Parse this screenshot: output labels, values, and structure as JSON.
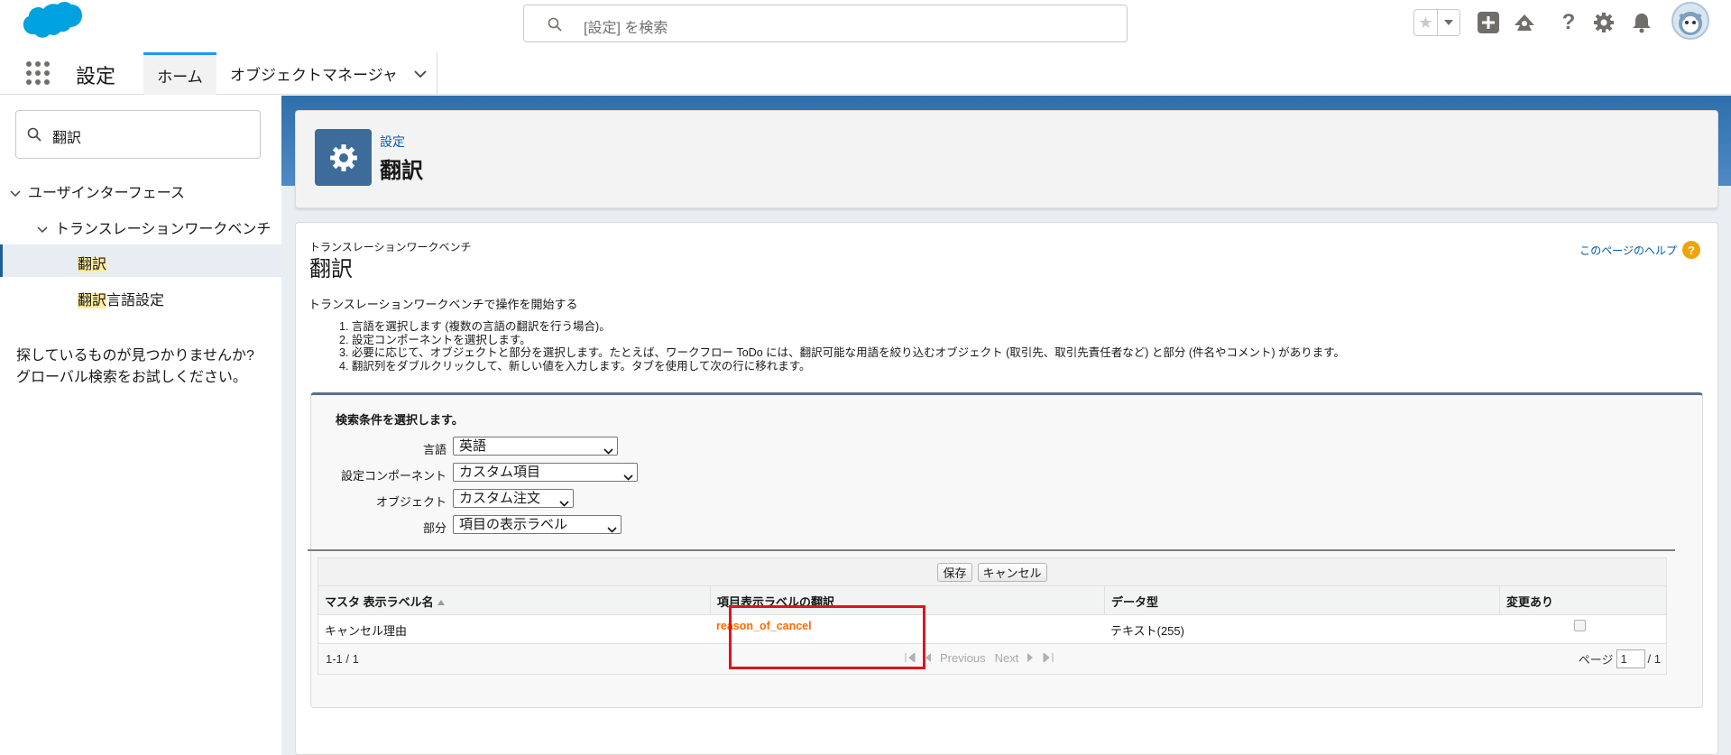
{
  "search": {
    "placeholder": "[設定] を検索"
  },
  "nav": {
    "app_name": "設定",
    "tab_home": "ホーム",
    "tab_object_manager": "オブジェクトマネージャ"
  },
  "sidebar": {
    "quick_find_value": "翻訳",
    "tree": [
      {
        "label": "ユーザインターフェース"
      },
      {
        "label": "トランスレーションワークベンチ"
      },
      {
        "highlight": "翻訳",
        "rest": ""
      },
      {
        "highlight": "翻訳",
        "rest": "言語設定"
      }
    ],
    "not_found_line1": "探しているものが見つかりませんか?",
    "not_found_line2": "グローバル検索をお試しください。"
  },
  "header": {
    "breadcrumb": "設定",
    "title": "翻訳"
  },
  "content": {
    "subtitle": "トランスレーションワークベンチ",
    "title": "翻訳",
    "help_link": "このページのヘルプ",
    "intro": "トランスレーションワークベンチで操作を開始する",
    "steps": [
      "1. 言語を選択します (複数の言語の翻訳を行う場合)。",
      "2. 設定コンポーネントを選択します。",
      "3. 必要に応じて、オブジェクトと部分を選択します。たとえば、ワークフロー ToDo には、翻訳可能な用語を絞り込むオブジェクト (取引先、取引先責任者など) と部分 (件名やコメント) があります。",
      "4. 翻訳列をダブルクリックして、新しい値を入力します。タブを使用して次の行に移れます。"
    ],
    "criteria_title": "検索条件を選択します。",
    "filters": {
      "language": {
        "label": "言語",
        "value": "英語"
      },
      "component": {
        "label": "設定コンポーネント",
        "value": "カスタム項目"
      },
      "object": {
        "label": "オブジェクト",
        "value": "カスタム注文"
      },
      "aspect": {
        "label": "部分",
        "value": "項目の表示ラベル"
      }
    },
    "save_button": "保存",
    "cancel_button": "キャンセル",
    "columns": {
      "master": "マスタ 表示ラベル名",
      "translation": "項目表示ラベルの翻訳",
      "data_type": "データ型",
      "changed": "変更あり"
    },
    "rows": [
      {
        "master": "キャンセル理由",
        "translation": "reason_of_cancel",
        "data_type": "テキスト(255)",
        "changed": false
      }
    ],
    "pager": {
      "range": "1-1 / 1",
      "previous": "Previous",
      "next": "Next",
      "page_label": "ページ",
      "page_value": "1",
      "page_total": "/ 1"
    }
  },
  "colors": {
    "brand": "#00a1e0",
    "accent": "#0176d3",
    "edited_text": "#ff6b00",
    "highlight_box": "#e0131f"
  }
}
